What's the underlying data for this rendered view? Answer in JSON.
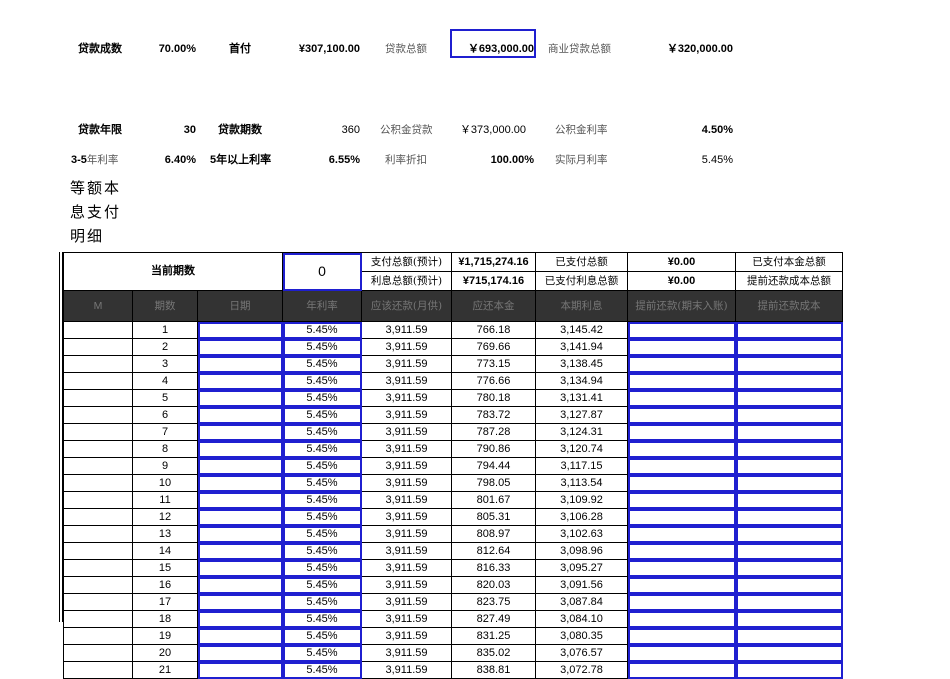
{
  "summary": {
    "loan_ratio_label": "贷款成数",
    "loan_ratio": "70.00%",
    "down_payment_label": "首付",
    "down_payment": "¥307,100.00",
    "total_loan_label": "贷款总额",
    "total_loan": "￥693,000.00",
    "commercial_loan_label": "商业贷款总额",
    "commercial_loan": "￥320,000.00",
    "years_label": "贷款年限",
    "years": "30",
    "periods_label": "贷款期数",
    "periods": "360",
    "fund_loan_label": "公积金贷款",
    "fund_loan": "￥373,000.00",
    "fund_rate_label": "公积金利率",
    "fund_rate": "4.50%",
    "rate_3_5_label_a": "3-5",
    "rate_3_5_label_b": "年利率",
    "rate_3_5": "6.40%",
    "rate_5plus_label": "5年以上利率",
    "rate_5plus": "6.55%",
    "discount_label": "利率折扣",
    "discount": "100.00%",
    "actual_rate_label": "实际月利率",
    "actual_rate": "5.45%"
  },
  "section_title": "等额本息支付明细",
  "stats": {
    "current_period_label": "当前期数",
    "current_period": "0",
    "total_pay_label": "支付总额(预计)",
    "total_pay": "¥1,715,274.16",
    "total_interest_label": "利息总额(预计)",
    "total_interest": "¥715,174.16",
    "paid_label": "已支付总额",
    "paid": "¥0.00",
    "paid_interest_label": "已支付利息总额",
    "paid_interest": "¥0.00",
    "paid_principal_label": "已支付本金总额",
    "prepay_cost_total_label": "提前还款成本总额"
  },
  "columns": [
    "M",
    "期数",
    "日期",
    "年利率",
    "应该还款(月供)",
    "应还本金",
    "本期利息",
    "提前还款(期末入账)",
    "提前还款成本"
  ],
  "rows": {
    "rate": "5.45%",
    "payment": "3,911.59",
    "principal": [
      "766.18",
      "769.66",
      "773.15",
      "776.66",
      "780.18",
      "783.72",
      "787.28",
      "790.86",
      "794.44",
      "798.05",
      "801.67",
      "805.31",
      "808.97",
      "812.64",
      "816.33",
      "820.03",
      "823.75",
      "827.49",
      "831.25",
      "835.02",
      "838.81"
    ],
    "interest": [
      "3,145.42",
      "3,141.94",
      "3,138.45",
      "3,134.94",
      "3,131.41",
      "3,127.87",
      "3,124.31",
      "3,120.74",
      "3,117.15",
      "3,113.54",
      "3,109.92",
      "3,106.28",
      "3,102.63",
      "3,098.96",
      "3,095.27",
      "3,091.56",
      "3,087.84",
      "3,084.10",
      "3,080.35",
      "3,076.57",
      "3,072.78"
    ]
  }
}
